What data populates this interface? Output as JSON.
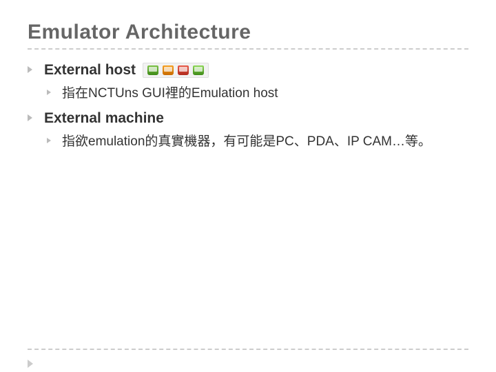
{
  "title": "Emulator Architecture",
  "items": [
    {
      "heading": "External host",
      "icon": "gui-host-nodes-icon",
      "sub": [
        "指在NCTUns GUI裡的Emulation host"
      ]
    },
    {
      "heading": "External machine",
      "icon": null,
      "sub": [
        "指欲emulation的真實機器，有可能是PC、PDA、IP CAM…等。"
      ]
    }
  ]
}
